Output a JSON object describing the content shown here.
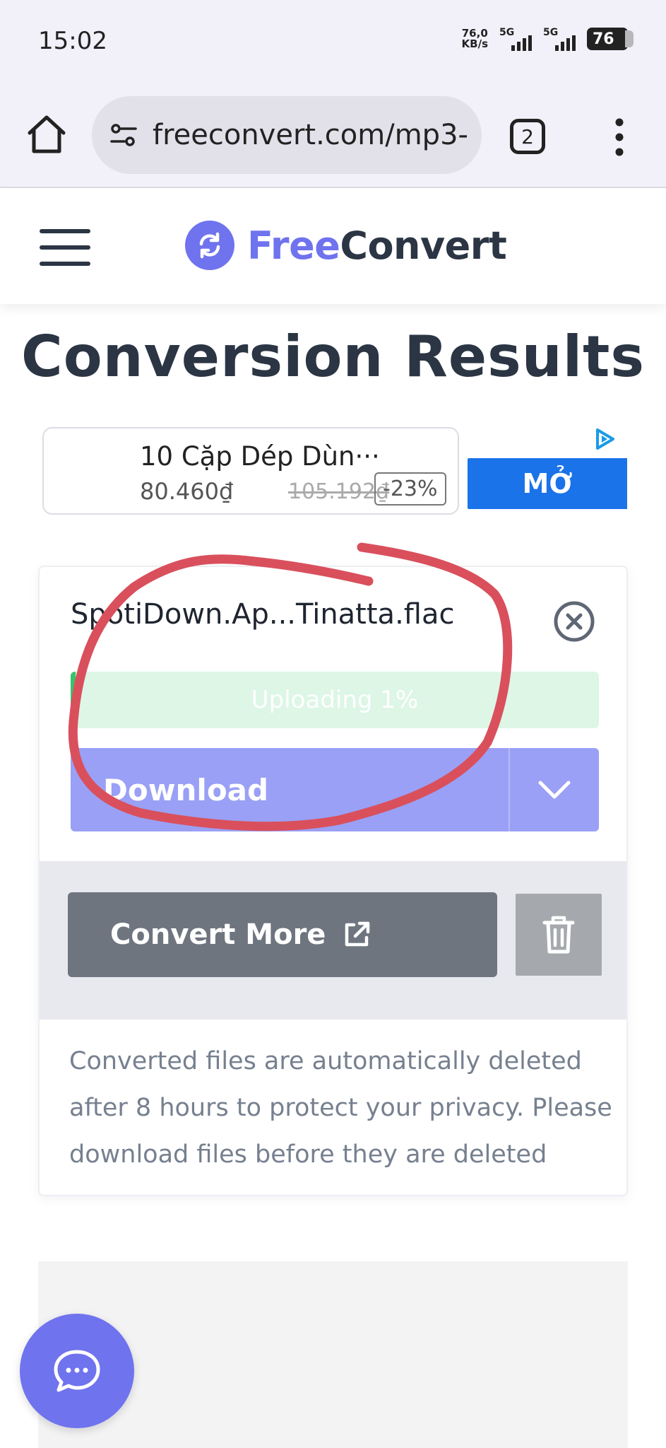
{
  "status_bar": {
    "time": "15:02",
    "net_speed_value": "76,0",
    "net_speed_unit": "KB/s",
    "signal_1": "5G",
    "signal_2": "5G",
    "battery": "76"
  },
  "browser": {
    "url": "freeconvert.com/mp3-",
    "tab_count": "2"
  },
  "header": {
    "logo_free": "Free",
    "logo_convert": "Convert"
  },
  "page": {
    "title": "Conversion Results"
  },
  "ad": {
    "title": "10 Cặp Dép Dùn···",
    "price": "80.460₫",
    "old_price": "105.192₫",
    "discount": "-23%",
    "cta": "MỞ"
  },
  "file": {
    "name": "SpotiDown.Ap...Tinatta.flac",
    "progress_label": "Uploading 1%",
    "progress_percent": 1,
    "download_label": "Download",
    "convert_more_label": "Convert More",
    "privacy_note": "Converted files are automatically deleted after 8 hours to protect your privacy. Please download files before they are deleted"
  },
  "colors": {
    "brand": "#6f73ee",
    "annotation": "#d9505c",
    "progress": "#36c46b"
  }
}
